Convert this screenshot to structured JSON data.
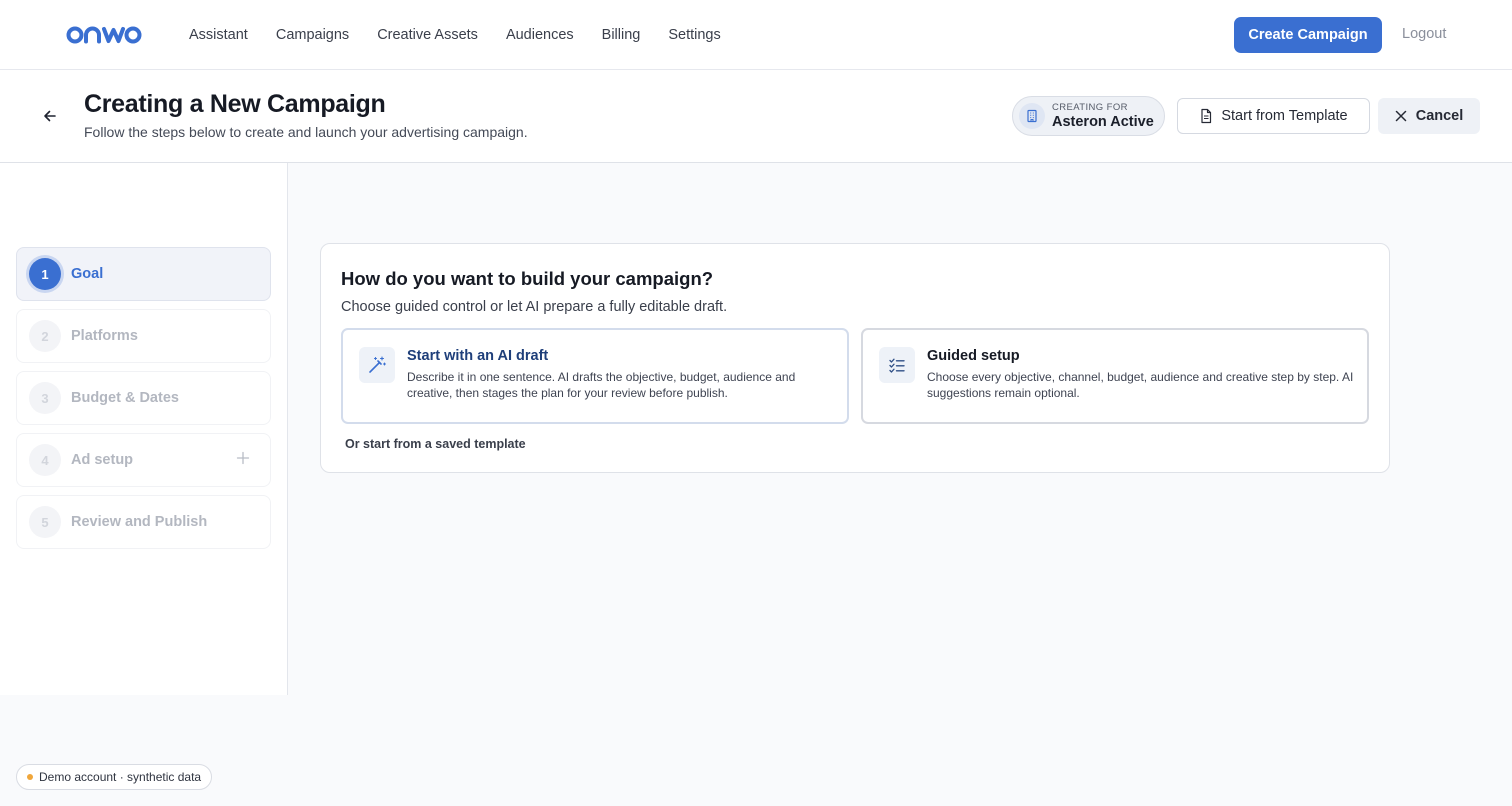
{
  "nav": {
    "logo_text": "onwo",
    "links": [
      "Assistant",
      "Campaigns",
      "Creative Assets",
      "Audiences",
      "Billing",
      "Settings"
    ],
    "create_button": "Create Campaign",
    "logout": "Logout"
  },
  "header": {
    "title": "Creating a New Campaign",
    "subtitle": "Follow the steps below to create and launch your advertising campaign.",
    "creating_for_label": "CREATING FOR",
    "creating_for_value": "Asteron Active",
    "template_button": "Start from Template",
    "cancel_button": "Cancel"
  },
  "steps": [
    {
      "num": "1",
      "label": "Goal",
      "active": true
    },
    {
      "num": "2",
      "label": "Platforms",
      "active": false
    },
    {
      "num": "3",
      "label": "Budget & Dates",
      "active": false
    },
    {
      "num": "4",
      "label": "Ad setup",
      "active": false
    },
    {
      "num": "5",
      "label": "Review and Publish",
      "active": false
    }
  ],
  "card": {
    "title": "How do you want to build your campaign?",
    "subtitle": "Choose guided control or let AI prepare a fully editable draft.",
    "ai_option": {
      "title": "Start with an AI draft",
      "description": "Describe it in one sentence. AI drafts the objective, budget, audience and creative, then stages the plan for your review before publish."
    },
    "guided_option": {
      "title": "Guided setup",
      "description": "Choose every objective, channel, budget, audience and creative step by step. AI suggestions remain optional."
    },
    "template_link": "Or start from a saved template"
  },
  "demo_badge": "Demo account · synthetic data",
  "colors": {
    "accent": "#3a6fd1",
    "demo_dot": "#f0a63a"
  }
}
